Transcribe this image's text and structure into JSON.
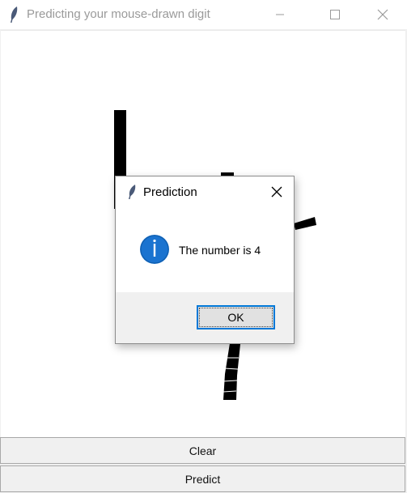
{
  "window": {
    "title": "Predicting your mouse-drawn digit",
    "icons": [
      "feather-icon",
      "minimize-icon",
      "maximize-icon",
      "close-icon"
    ]
  },
  "buttons": {
    "clear_label": "Clear",
    "predict_label": "Predict"
  },
  "dialog": {
    "title": "Prediction",
    "message": "The number is 4",
    "ok_label": "OK",
    "icon": "info-icon",
    "accent": "#0078d7"
  }
}
